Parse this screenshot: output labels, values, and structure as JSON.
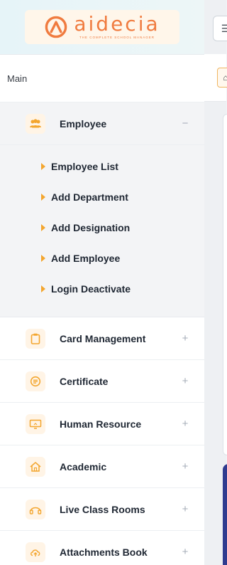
{
  "brand": {
    "name": "aidecia",
    "tagline": "THE COMPLETE SCHOOL MANAGER"
  },
  "nav": {
    "section_label": "Main",
    "items": [
      {
        "label": "Employee",
        "icon": "users-icon",
        "toggle": "−",
        "expanded": true,
        "children": [
          {
            "label": "Employee List"
          },
          {
            "label": "Add Department"
          },
          {
            "label": "Add Designation"
          },
          {
            "label": "Add Employee"
          },
          {
            "label": "Login Deactivate"
          }
        ]
      },
      {
        "label": "Card Management",
        "icon": "clipboard-icon",
        "toggle": "+"
      },
      {
        "label": "Certificate",
        "icon": "certificate-icon",
        "toggle": "+"
      },
      {
        "label": "Human Resource",
        "icon": "monitor-icon",
        "toggle": "+"
      },
      {
        "label": "Academic",
        "icon": "home-icon",
        "toggle": "+"
      },
      {
        "label": "Live Class Rooms",
        "icon": "headphones-icon",
        "toggle": "+"
      },
      {
        "label": "Attachments Book",
        "icon": "cloud-upload-icon",
        "toggle": "+"
      }
    ]
  },
  "header": {
    "menu_toggle_icon": "hamburger-icon",
    "home_icon": "home-icon"
  },
  "colors": {
    "accent": "#f3a62f",
    "brand": "#f07b3f",
    "icon_bg": "#fff4e6",
    "active_bg": "#f3f4f6",
    "blue_panel": "#2f3b8f"
  }
}
